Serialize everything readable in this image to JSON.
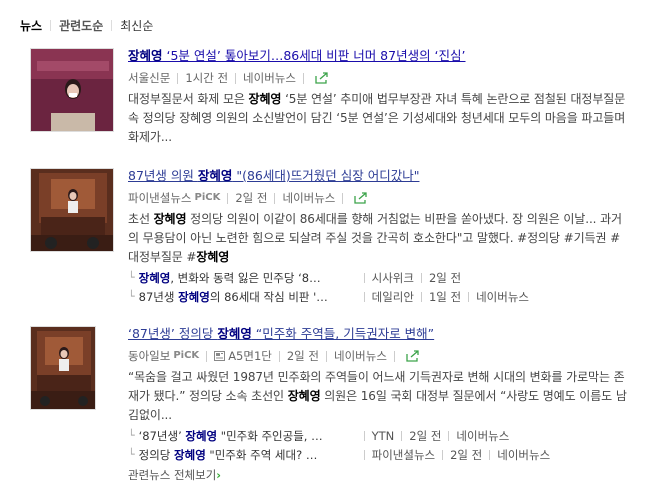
{
  "tabs": [
    {
      "label": "뉴스"
    },
    {
      "label": "관련도순"
    },
    {
      "label": "최신순"
    }
  ],
  "articles": [
    {
      "title_bold": "장혜영",
      "title_rest": " ‘5분 연설’ 톺아보기…86세대 비판 너머 87년생의 ‘진심’",
      "press": "서울신문",
      "pick": "",
      "page": "",
      "time": "1시간 전",
      "naver": "네이버뉴스",
      "desc_pre": "대정부질문서 화제 모은 ",
      "desc_bold": "장혜영",
      "desc_post": " ‘5분 연설’ 추미애 법무부장관 자녀 특혜 논란으로 점철된 대정부질문 속 정의당 장혜영 의원의 소신발언이 담긴 ‘5분 연설’은 기성세대와 청년세대 모두의 마음을 파고들며 화제가..."
    },
    {
      "title_pre": "87년생 의원 ",
      "title_bold": "장혜영",
      "title_rest": " \"(86세대)뜨거웠던 심장 어디갔나\"",
      "press": "파이낸셜뉴스",
      "pick": "PiCK",
      "time": "2일 전",
      "naver": "네이버뉴스",
      "desc_pre": "초선 ",
      "desc_bold": "장혜영",
      "desc_post": " 정의당 의원이 이같이 86세대를 향해 거침없는 비판을 쏟아냈다. 장 의원은 이날... 과거의 무용담이 아닌 노련한 힘으로 되살려 주실 것을 간곡히 호소한다\"고 말했다. #정의당 #기득권 #대정부질문 #",
      "desc_bold2": "장혜영",
      "related": [
        {
          "bold": "장혜영",
          "rest": ", 변화와 동력 잃은 민주당 ‘8…",
          "press": "시사위크",
          "time": "2일 전",
          "naver": ""
        },
        {
          "pre": "87년생 ",
          "bold": "장혜영",
          "rest": "의 86세대 작심 비판 '…",
          "press": "데일리안",
          "time": "1일 전",
          "naver": "네이버뉴스"
        }
      ]
    },
    {
      "title_pre": "‘87년생’ 정의당 ",
      "title_bold": "장혜영",
      "title_rest": " “민주화 주역들, 기득권자로 변해”",
      "press": "동아일보",
      "pick": "PiCK",
      "page": "A5면1단",
      "time": "2일 전",
      "naver": "네이버뉴스",
      "desc_pre": "“목숨을 걸고 싸웠던 1987년 민주화의 주역들이 어느새 기득권자로 변해 시대의 변화를 가로막는 존재가 됐다.” 정의당 소속 초선인 ",
      "desc_bold": "장혜영",
      "desc_post": " 의원은 16일 국회 대정부 질문에서 “사랑도 명예도 이름도 남김없이...",
      "related": [
        {
          "pre": "‘87년생’ ",
          "bold": "장혜영",
          "rest": " \"민주화 주인공들, …",
          "press": "YTN",
          "time": "2일 전",
          "naver": "네이버뉴스"
        },
        {
          "pre": "정의당 ",
          "bold": "장혜영",
          "rest": " \"민주화 주역 세대? …",
          "press": "파이낸셜뉴스",
          "time": "2일 전",
          "naver": "네이버뉴스"
        }
      ],
      "more": "관련뉴스 전체보기",
      "more_arrow": "›"
    }
  ],
  "colors": {
    "link": "#1a0dab",
    "bold_name": "#000080",
    "green_icon": "#3ca34a"
  }
}
